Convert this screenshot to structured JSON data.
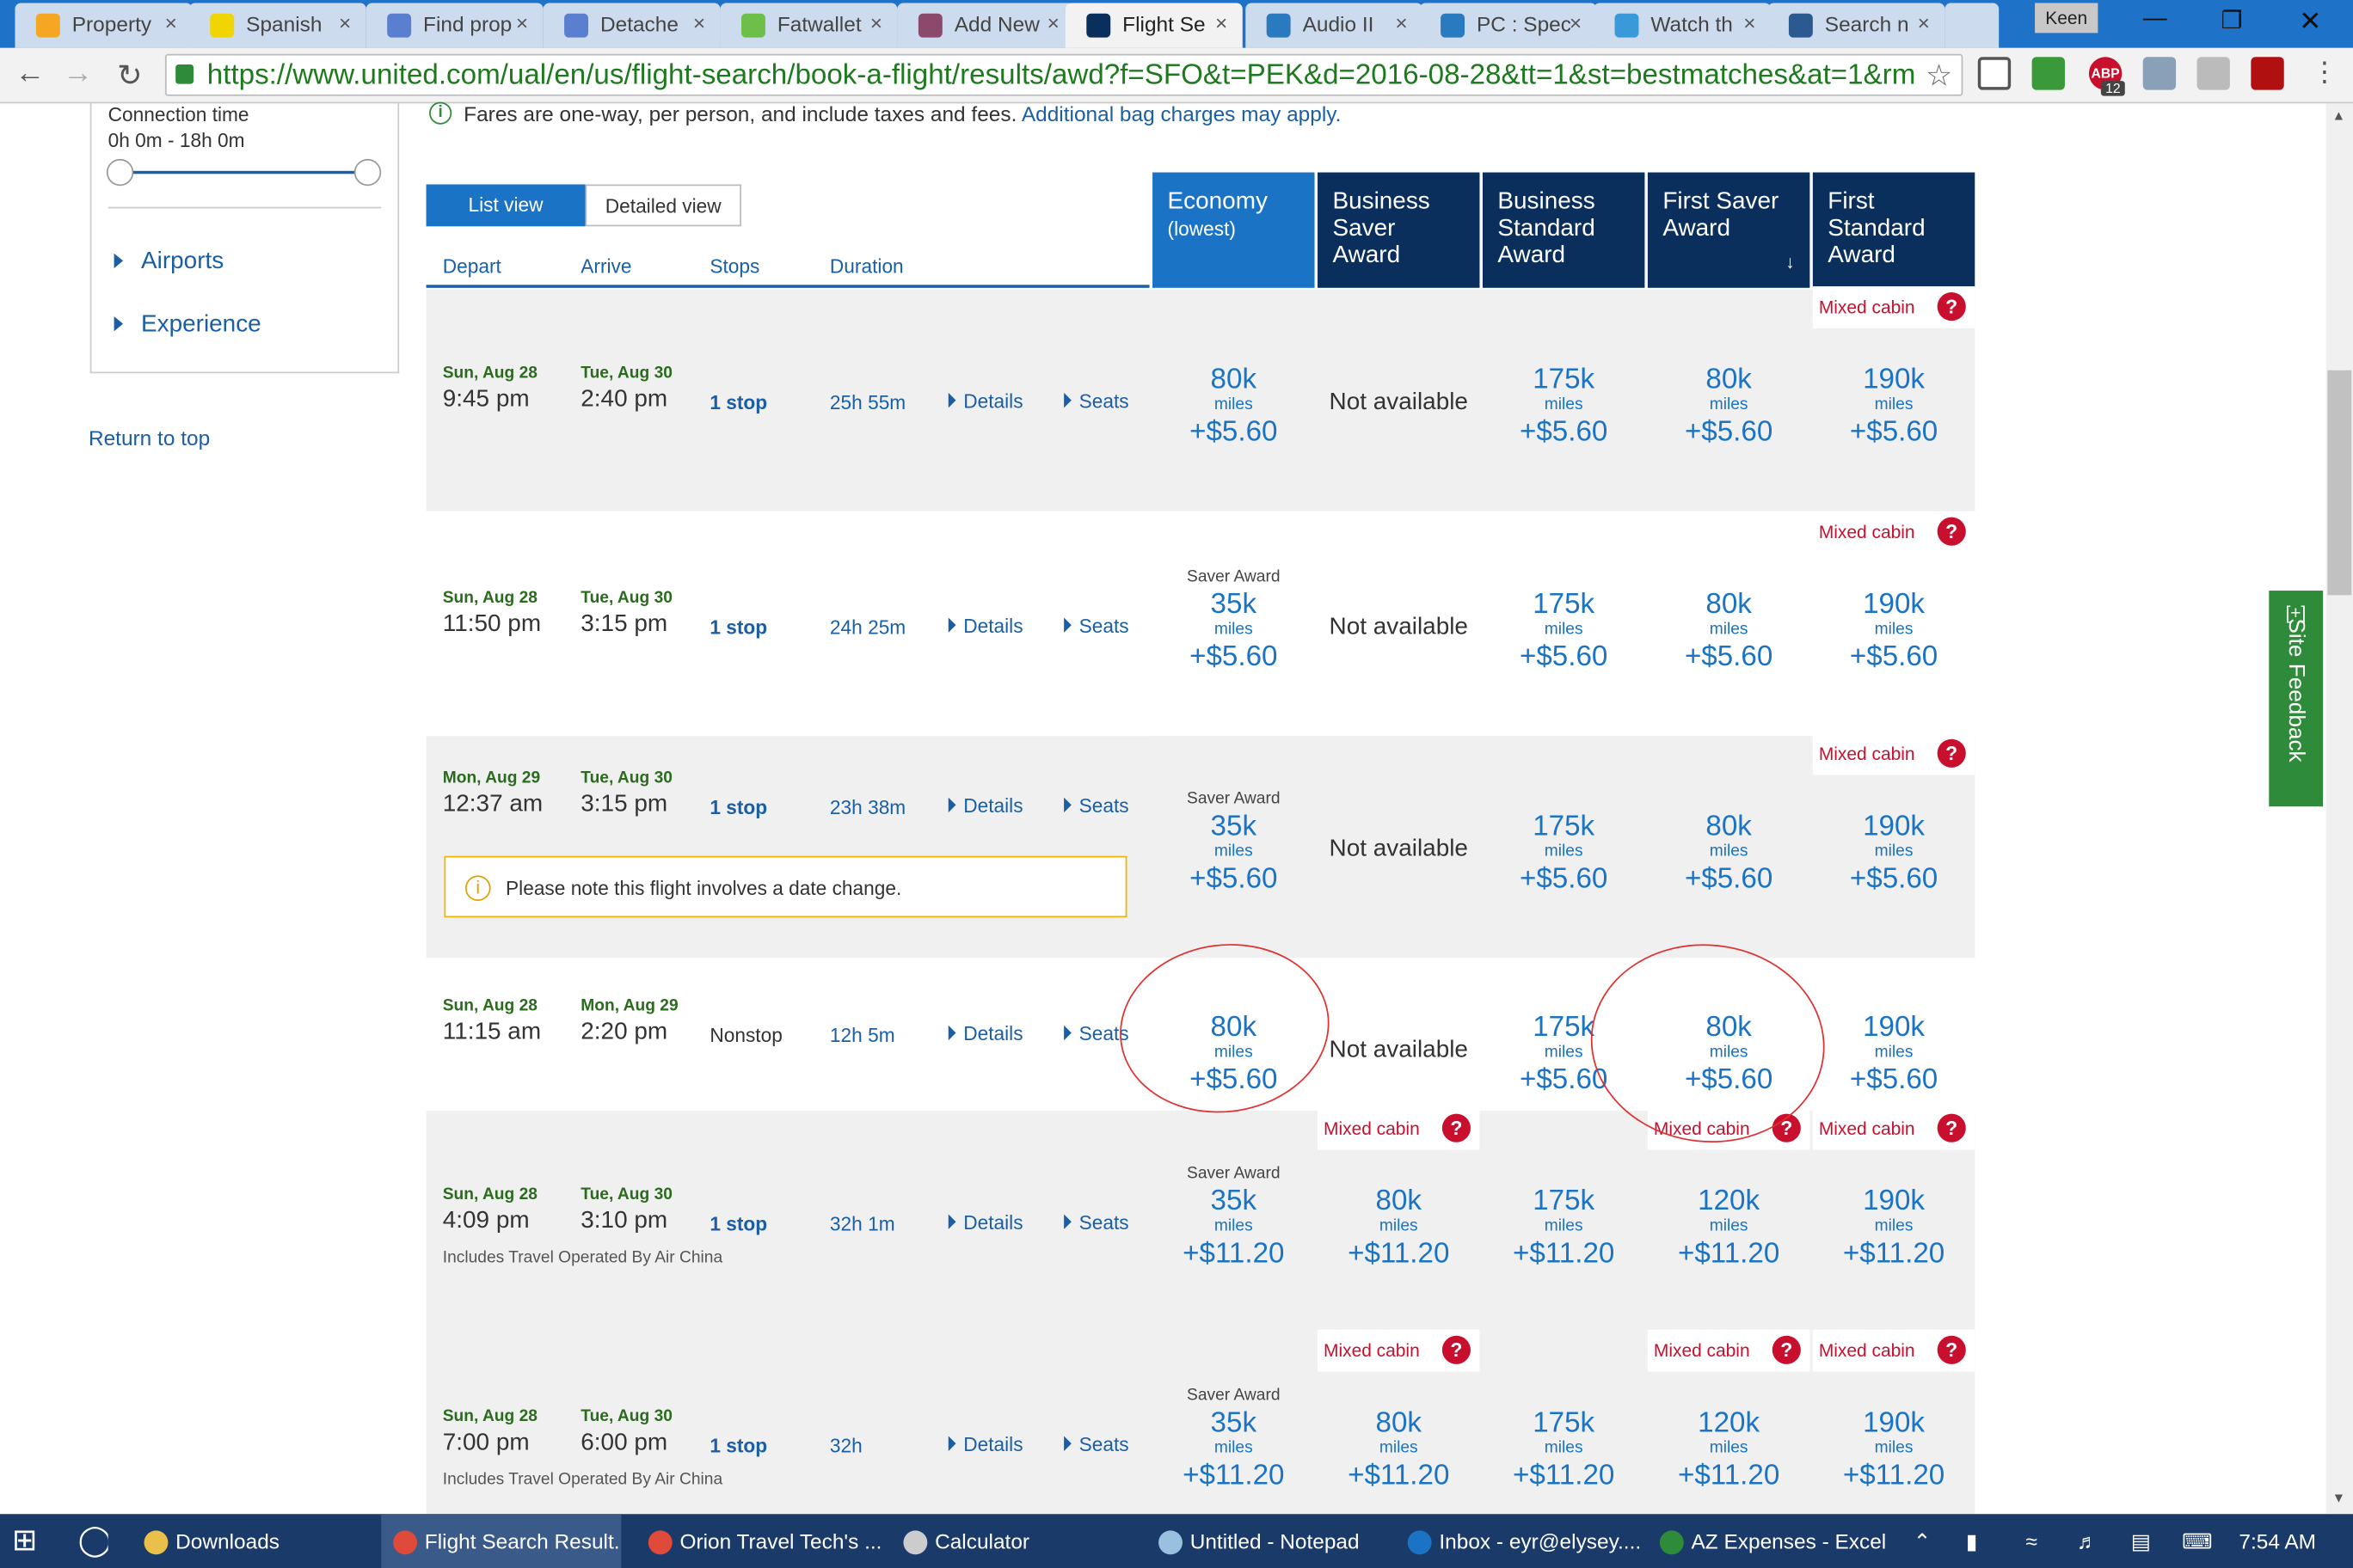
{
  "browser": {
    "tabs": [
      {
        "title": "Property",
        "color": "#f5a623"
      },
      {
        "title": "Spanish",
        "color": "#f1d500"
      },
      {
        "title": "Find prop",
        "color": "#5a7fd0"
      },
      {
        "title": "Detache",
        "color": "#5a7fd0"
      },
      {
        "title": "Fatwallet",
        "color": "#6cc04a"
      },
      {
        "title": "Add New",
        "color": "#8b4a6b"
      },
      {
        "title": "Flight Se",
        "color": "#0b2f5c"
      },
      {
        "title": "Audio II",
        "color": "#2a7ac0"
      },
      {
        "title": "PC : Spec",
        "color": "#2a7ac0"
      },
      {
        "title": "Watch th",
        "color": "#3a9ad9"
      },
      {
        "title": "Search n",
        "color": "#2a5a90"
      }
    ],
    "user": "Keen",
    "url": "https://www.united.com/ual/en/us/flight-search/book-a-flight/results/awd?f=SFO&t=PEK&d=2016-08-28&tt=1&st=bestmatches&at=1&rm:",
    "abp_count": "12"
  },
  "sidebar": {
    "connection_label": "Connection time",
    "connection_range": "0h 0m - 18h 0m",
    "airports": "Airports",
    "experience": "Experience",
    "return_top": "Return to top"
  },
  "notice": {
    "main": "Fares are one-way, per person, and include taxes and fees.",
    "link": "Additional bag charges may apply."
  },
  "views": {
    "list": "List view",
    "detailed": "Detailed view"
  },
  "columns": {
    "depart": "Depart",
    "arrive": "Arrive",
    "stops": "Stops",
    "duration": "Duration"
  },
  "fare_headers": [
    {
      "title": "Economy",
      "sub": "(lowest)"
    },
    {
      "title": "Business Saver Award",
      "sub": ""
    },
    {
      "title": "Business Standard Award",
      "sub": ""
    },
    {
      "title": "First Saver Award",
      "sub": "↓"
    },
    {
      "title": "First Standard Award",
      "sub": ""
    }
  ],
  "labels": {
    "details": "Details",
    "seats": "Seats",
    "miles": "miles",
    "not_available": "Not available",
    "mixed_cabin": "Mixed cabin",
    "saver_award": "Saver Award",
    "date_change": "Please note this flight involves a date change.",
    "operated": "Includes Travel Operated By Air China",
    "feedback": "Site Feedback",
    "feedback_icon": "[+]"
  },
  "flights": [
    {
      "dep_date": "Sun, Aug 28",
      "dep_time": "9:45 pm",
      "arr_date": "Tue, Aug 30",
      "arr_time": "2:40 pm",
      "stops": "1 stop",
      "duration": "25h 55m",
      "fares": [
        {
          "saver": "",
          "miles": "80k",
          "price": "+$5.60"
        },
        {
          "na": true
        },
        {
          "miles": "175k",
          "price": "+$5.60"
        },
        {
          "miles": "80k",
          "price": "+$5.60"
        },
        {
          "miles": "190k",
          "price": "+$5.60",
          "mixed": true
        }
      ]
    },
    {
      "dep_date": "Sun, Aug 28",
      "dep_time": "11:50 pm",
      "arr_date": "Tue, Aug 30",
      "arr_time": "3:15 pm",
      "stops": "1 stop",
      "duration": "24h 25m",
      "fares": [
        {
          "saver": "Saver Award",
          "miles": "35k",
          "price": "+$5.60"
        },
        {
          "na": true
        },
        {
          "miles": "175k",
          "price": "+$5.60"
        },
        {
          "miles": "80k",
          "price": "+$5.60"
        },
        {
          "miles": "190k",
          "price": "+$5.60",
          "mixed": true
        }
      ]
    },
    {
      "dep_date": "Mon, Aug 29",
      "dep_time": "12:37 am",
      "arr_date": "Tue, Aug 30",
      "arr_time": "3:15 pm",
      "stops": "1 stop",
      "duration": "23h 38m",
      "fares": [
        {
          "saver": "Saver Award",
          "miles": "35k",
          "price": "+$5.60"
        },
        {
          "na": true
        },
        {
          "miles": "175k",
          "price": "+$5.60"
        },
        {
          "miles": "80k",
          "price": "+$5.60"
        },
        {
          "miles": "190k",
          "price": "+$5.60",
          "mixed": true
        }
      ]
    },
    {
      "dep_date": "Sun, Aug 28",
      "dep_time": "11:15 am",
      "arr_date": "Mon, Aug 29",
      "arr_time": "2:20 pm",
      "stops": "Nonstop",
      "duration": "12h 5m",
      "fares": [
        {
          "miles": "80k",
          "price": "+$5.60"
        },
        {
          "na": true
        },
        {
          "miles": "175k",
          "price": "+$5.60"
        },
        {
          "miles": "80k",
          "price": "+$5.60"
        },
        {
          "miles": "190k",
          "price": "+$5.60"
        }
      ]
    },
    {
      "dep_date": "Sun, Aug 28",
      "dep_time": "4:09 pm",
      "arr_date": "Tue, Aug 30",
      "arr_time": "3:10 pm",
      "stops": "1 stop",
      "duration": "32h 1m",
      "fares": [
        {
          "saver": "Saver Award",
          "miles": "35k",
          "price": "+$11.20"
        },
        {
          "miles": "80k",
          "price": "+$11.20",
          "mixed": true
        },
        {
          "miles": "175k",
          "price": "+$11.20"
        },
        {
          "miles": "120k",
          "price": "+$11.20",
          "mixed": true
        },
        {
          "miles": "190k",
          "price": "+$11.20",
          "mixed": true
        }
      ]
    },
    {
      "dep_date": "Sun, Aug 28",
      "dep_time": "7:00 pm",
      "arr_date": "Tue, Aug 30",
      "arr_time": "6:00 pm",
      "stops": "1 stop",
      "duration": "32h",
      "fares": [
        {
          "saver": "Saver Award",
          "miles": "35k",
          "price": "+$11.20"
        },
        {
          "miles": "80k",
          "price": "+$11.20",
          "mixed": true
        },
        {
          "miles": "175k",
          "price": "+$11.20"
        },
        {
          "miles": "120k",
          "price": "+$11.20",
          "mixed": true
        },
        {
          "miles": "190k",
          "price": "+$11.20",
          "mixed": true
        }
      ]
    }
  ],
  "taskbar": {
    "items": [
      {
        "label": "Downloads",
        "color": "#e8c04a"
      },
      {
        "label": "Flight Search Result...",
        "color": "#e04a3a"
      },
      {
        "label": "Orion Travel Tech's ...",
        "color": "#e04a3a"
      },
      {
        "label": "Calculator",
        "color": "#cccccc"
      },
      {
        "label": "Untitled - Notepad",
        "color": "#9ac0e0"
      },
      {
        "label": "Inbox - eyr@elysey....",
        "color": "#1a73c4"
      },
      {
        "label": "AZ Expenses - Excel",
        "color": "#2e8b3a"
      }
    ],
    "clock": "7:54 AM"
  }
}
